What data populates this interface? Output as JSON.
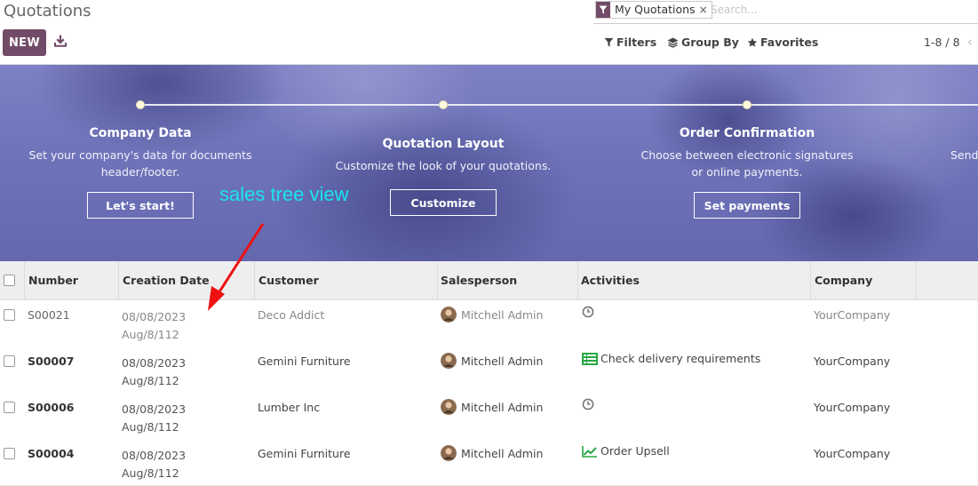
{
  "header": {
    "title": "Quotations",
    "new_label": "NEW",
    "search": {
      "facet_label": "My Quotations",
      "facet_close": "×",
      "placeholder": "Search..."
    },
    "filters_label": "Filters",
    "group_by_label": "Group By",
    "favorites_label": "Favorites",
    "pager": "1-8 / 8",
    "pager_prev": "‹"
  },
  "banner": {
    "steps": [
      {
        "title": "Company Data",
        "desc_line1": "Set your company's data for documents",
        "desc_line2": "header/footer.",
        "button": "Let's start!"
      },
      {
        "title": "Quotation Layout",
        "desc_line1": "Customize the look of your quotations.",
        "desc_line2": "",
        "button": "Customize"
      },
      {
        "title": "Order Confirmation",
        "desc_line1": "Choose between electronic signatures",
        "desc_line2": "or online payments.",
        "button": "Set payments"
      },
      {
        "title": "",
        "desc_line1": "Send",
        "desc_line2": "",
        "button": ""
      }
    ],
    "annotation": "sales tree view",
    "colors": {
      "banner": "#6f74ba",
      "annotation": "#19e4f0",
      "arrow": "#ee1111"
    }
  },
  "list": {
    "columns": [
      "Number",
      "Creation Date",
      "Customer",
      "Salesperson",
      "Activities",
      "Company"
    ],
    "rows": [
      {
        "number": "S00021",
        "date": "08/08/2023",
        "date2": "Aug/8/112",
        "customer": "Deco Addict",
        "salesperson": "Mitchell Admin",
        "activity_icon": "clock-icon",
        "activity": "",
        "company": "YourCompany"
      },
      {
        "number": "S00007",
        "date": "08/08/2023",
        "date2": "Aug/8/112",
        "customer": "Gemini Furniture",
        "salesperson": "Mitchell Admin",
        "activity_icon": "todo-list-icon",
        "activity": "Check delivery requirements",
        "company": "YourCompany"
      },
      {
        "number": "S00006",
        "date": "08/08/2023",
        "date2": "Aug/8/112",
        "customer": "Lumber Inc",
        "salesperson": "Mitchell Admin",
        "activity_icon": "clock-icon",
        "activity": "",
        "company": "YourCompany"
      },
      {
        "number": "S00004",
        "date": "08/08/2023",
        "date2": "Aug/8/112",
        "customer": "Gemini Furniture",
        "salesperson": "Mitchell Admin",
        "activity_icon": "upsell-chart-icon",
        "activity": "Order Upsell",
        "company": "YourCompany"
      }
    ]
  },
  "colors": {
    "primary": "#714b67",
    "activity_green": "#28a745"
  }
}
